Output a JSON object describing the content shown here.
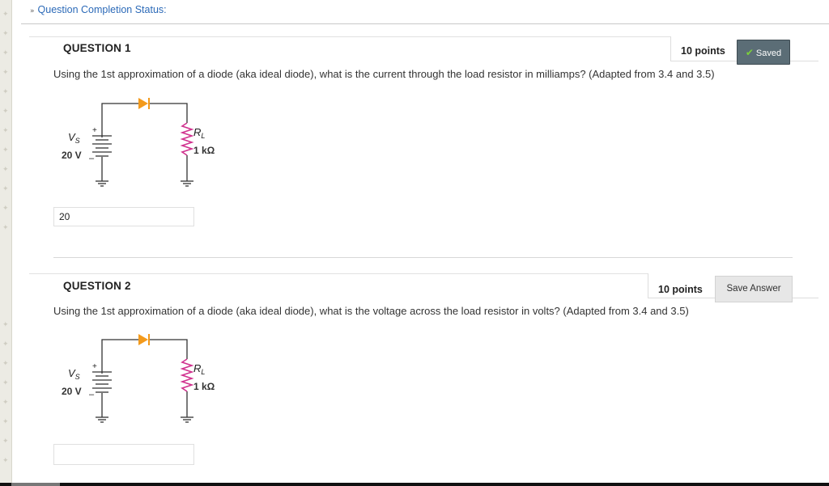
{
  "status": {
    "toggle_label": "Question Completion Status:"
  },
  "questions": [
    {
      "title": "QUESTION 1",
      "points": "10 points",
      "button_label": "Saved",
      "button_state": "saved",
      "text": "Using the 1st approximation of a diode (aka ideal diode), what is the current through the load resistor in milliamps? (Adapted from 3.4 and 3.5)",
      "circuit": {
        "source_symbol": "V",
        "source_sub": "S",
        "source_value": "20 V",
        "plus": "+",
        "minus": "–",
        "resistor_symbol": "R",
        "resistor_sub": "L",
        "resistor_value": "1 kΩ"
      },
      "answer": "20"
    },
    {
      "title": "QUESTION 2",
      "points": "10 points",
      "button_label": "Save Answer",
      "button_state": "unsaved",
      "text": "Using the 1st approximation of a diode (aka ideal diode), what is the voltage across the load resistor in volts?  (Adapted from 3.4 and 3.5)",
      "circuit": {
        "source_symbol": "V",
        "source_sub": "S",
        "source_value": "20 V",
        "plus": "+",
        "minus": "–",
        "resistor_symbol": "R",
        "resistor_sub": "L",
        "resistor_value": "1 kΩ"
      },
      "answer": ""
    }
  ],
  "colors": {
    "link": "#2c6ab8",
    "diode": "#f39a1c",
    "resistor": "#d0318e",
    "saved_button": "#5b6d76",
    "check": "#7bd13a"
  }
}
